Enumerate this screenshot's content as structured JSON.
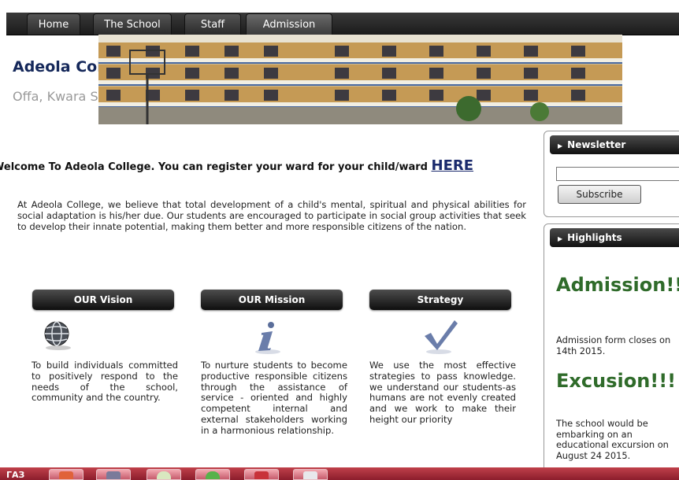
{
  "nav": {
    "tabs": [
      {
        "label": "Home"
      },
      {
        "label": "The School"
      },
      {
        "label": "Staff"
      },
      {
        "label": "Admission"
      }
    ]
  },
  "header": {
    "title": "Adeola College",
    "subtitle": "Offa, Kwara State"
  },
  "welcome": {
    "text": "Welcome To Adeola College. You can register your ward for your child/ward ",
    "link": "HERE"
  },
  "intro": "At Adeola College, we believe that total development of a child's mental, spiritual and physical abilities for social adaptation is his/her due. Our students are encouraged to participate in social group activities that seek to develop their innate potential, making them better and more responsible citizens of the nation.",
  "columns": [
    {
      "heading": "OUR Vision",
      "icon": "globe-icon",
      "text": "To build individuals committed to positively respond to the needs of the school, community and the country."
    },
    {
      "heading": "OUR Mission",
      "icon": "info-icon",
      "text": "To nurture students to become productive responsible citizens through the assistance of service - oriented and highly competent internal and external stakeholders working in a harmonious relationship."
    },
    {
      "heading": "Strategy",
      "icon": "checkmark-icon",
      "text": "We use the most effective strategies to pass knowledge. we understand our students-as humans are not evenly created and we work to make their height our priority"
    }
  ],
  "sidebar": {
    "newsletter": {
      "heading": "Newsletter",
      "input_value": "",
      "button": "Subscribe"
    },
    "highlights": {
      "heading": "Highlights",
      "items": [
        {
          "title": "Admission!!",
          "text": "Admission form closes on 14th 2015."
        },
        {
          "title": "Excusion!!!",
          "text": "The school would be embarking on an educational excursion on August 24 2015."
        }
      ]
    }
  },
  "taskbar": {
    "label": "ГАЗ"
  },
  "colors": {
    "title": "#15285a",
    "highlight": "#2f6b2a",
    "taskbar": "#a32a3a"
  }
}
